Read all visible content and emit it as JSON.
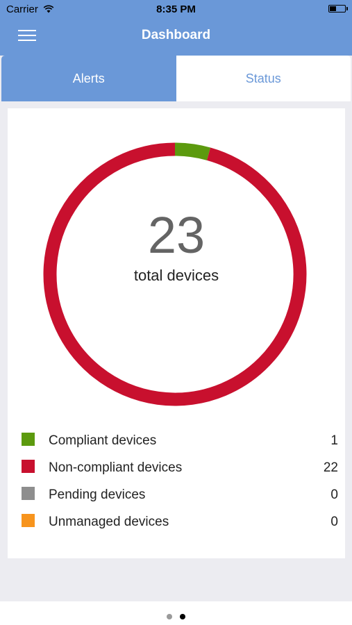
{
  "status_bar": {
    "carrier": "Carrier",
    "time": "8:35 PM",
    "battery_level": 0.45
  },
  "header": {
    "title": "Dashboard",
    "menu_icon": "hamburger-icon"
  },
  "tabs": [
    {
      "label": "Alerts",
      "active": true
    },
    {
      "label": "Status",
      "active": false
    }
  ],
  "summary": {
    "total": "23",
    "total_label": "total devices"
  },
  "legend": [
    {
      "label": "Compliant devices",
      "count": "1",
      "value": 1,
      "color": "#5c9a0e"
    },
    {
      "label": "Non-compliant devices",
      "count": "22",
      "value": 22,
      "color": "#c8102e"
    },
    {
      "label": "Pending devices",
      "count": "0",
      "value": 0,
      "color": "#8e8e8e"
    },
    {
      "label": "Unmanaged devices",
      "count": "0",
      "value": 0,
      "color": "#f7941d"
    }
  ],
  "page_indicator": {
    "pages": 2,
    "current": 1
  },
  "colors": {
    "header": "#6a98d8",
    "background": "#ececf1"
  }
}
